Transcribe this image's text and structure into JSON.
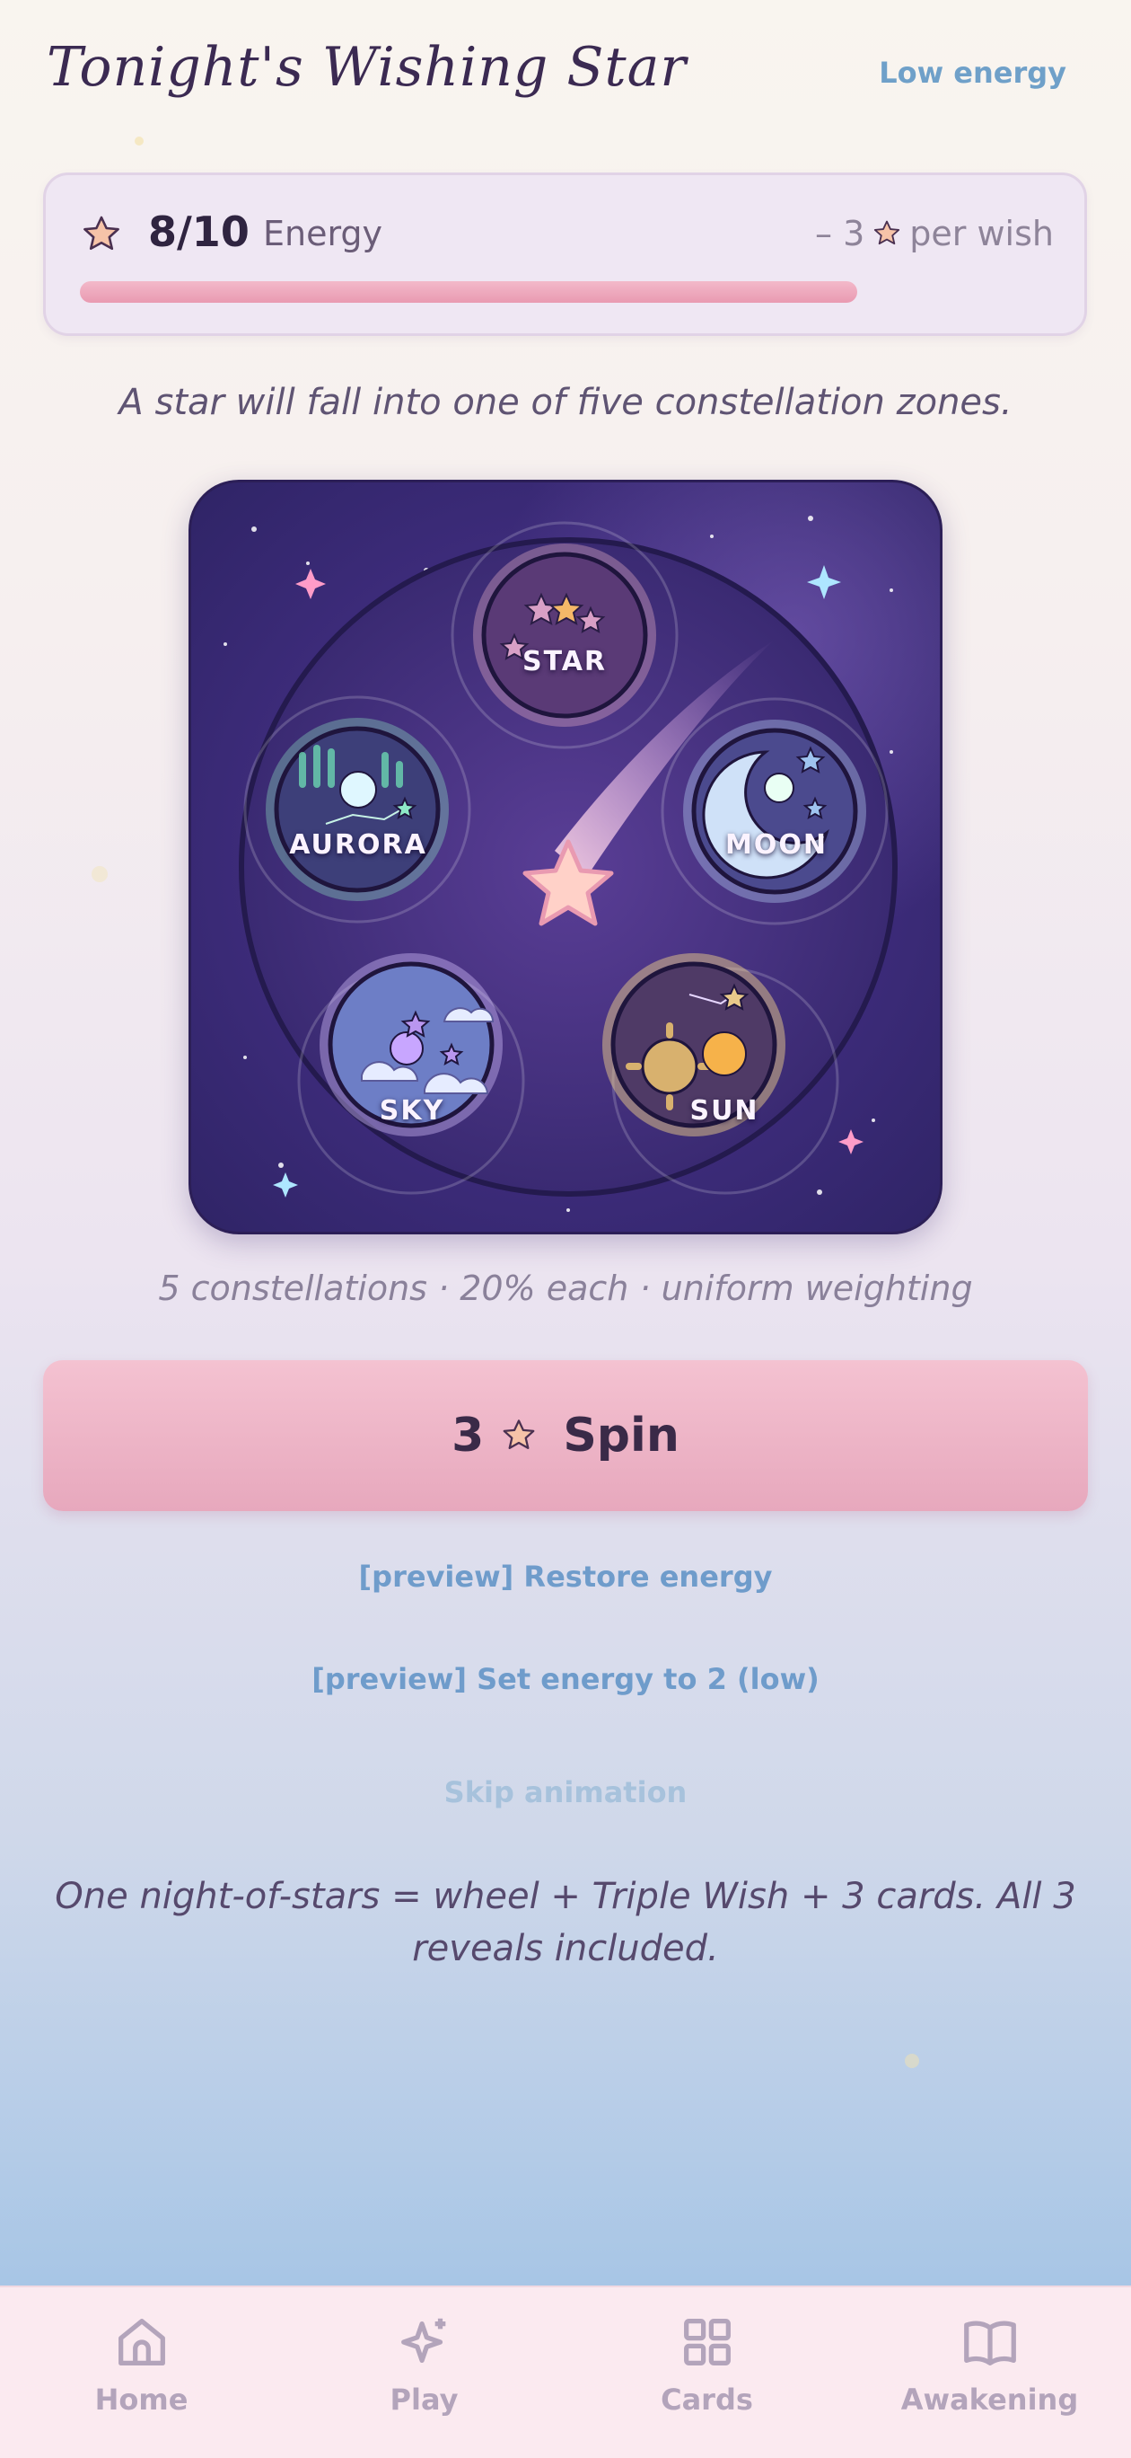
{
  "header": {
    "title": "Tonight's Wishing Star",
    "status_link": "Low energy"
  },
  "energy": {
    "count": "8/10",
    "label": "Energy",
    "cost_prefix": "– 3",
    "cost_suffix": "per wish",
    "fill_fraction": 0.8,
    "icon": "star-icon"
  },
  "intro_text": "A star will fall into one of five constellation zones.",
  "wheel": {
    "zones": [
      {
        "label": "STAR",
        "color": "#f2b6c8"
      },
      {
        "label": "MOON",
        "color": "#bfe0ff"
      },
      {
        "label": "SUN",
        "color": "#f8d98a"
      },
      {
        "label": "SKY",
        "color": "#d8c2ff"
      },
      {
        "label": "AURORA",
        "color": "#8fe7c4"
      }
    ]
  },
  "odds_text": "5 constellations · 20% each · uniform weighting",
  "spin_button": {
    "cost": "3",
    "label": "Spin"
  },
  "links": {
    "restore": "[preview] Restore energy",
    "set_low": "[preview] Set energy to 2 (low)",
    "skip": "Skip animation"
  },
  "footer_note": "One night-of-stars = wheel + Triple Wish + 3 cards. All 3 reveals included.",
  "nav": {
    "items": [
      {
        "label": "Home",
        "icon": "home-icon"
      },
      {
        "label": "Play",
        "icon": "sparkle-icon"
      },
      {
        "label": "Cards",
        "icon": "grid-icon"
      },
      {
        "label": "Awakening",
        "icon": "book-icon"
      }
    ]
  },
  "colors": {
    "accent_pink": "#e99ab1",
    "link_blue": "#6f9ccb",
    "wheel_bg": "#3e2c7c"
  }
}
